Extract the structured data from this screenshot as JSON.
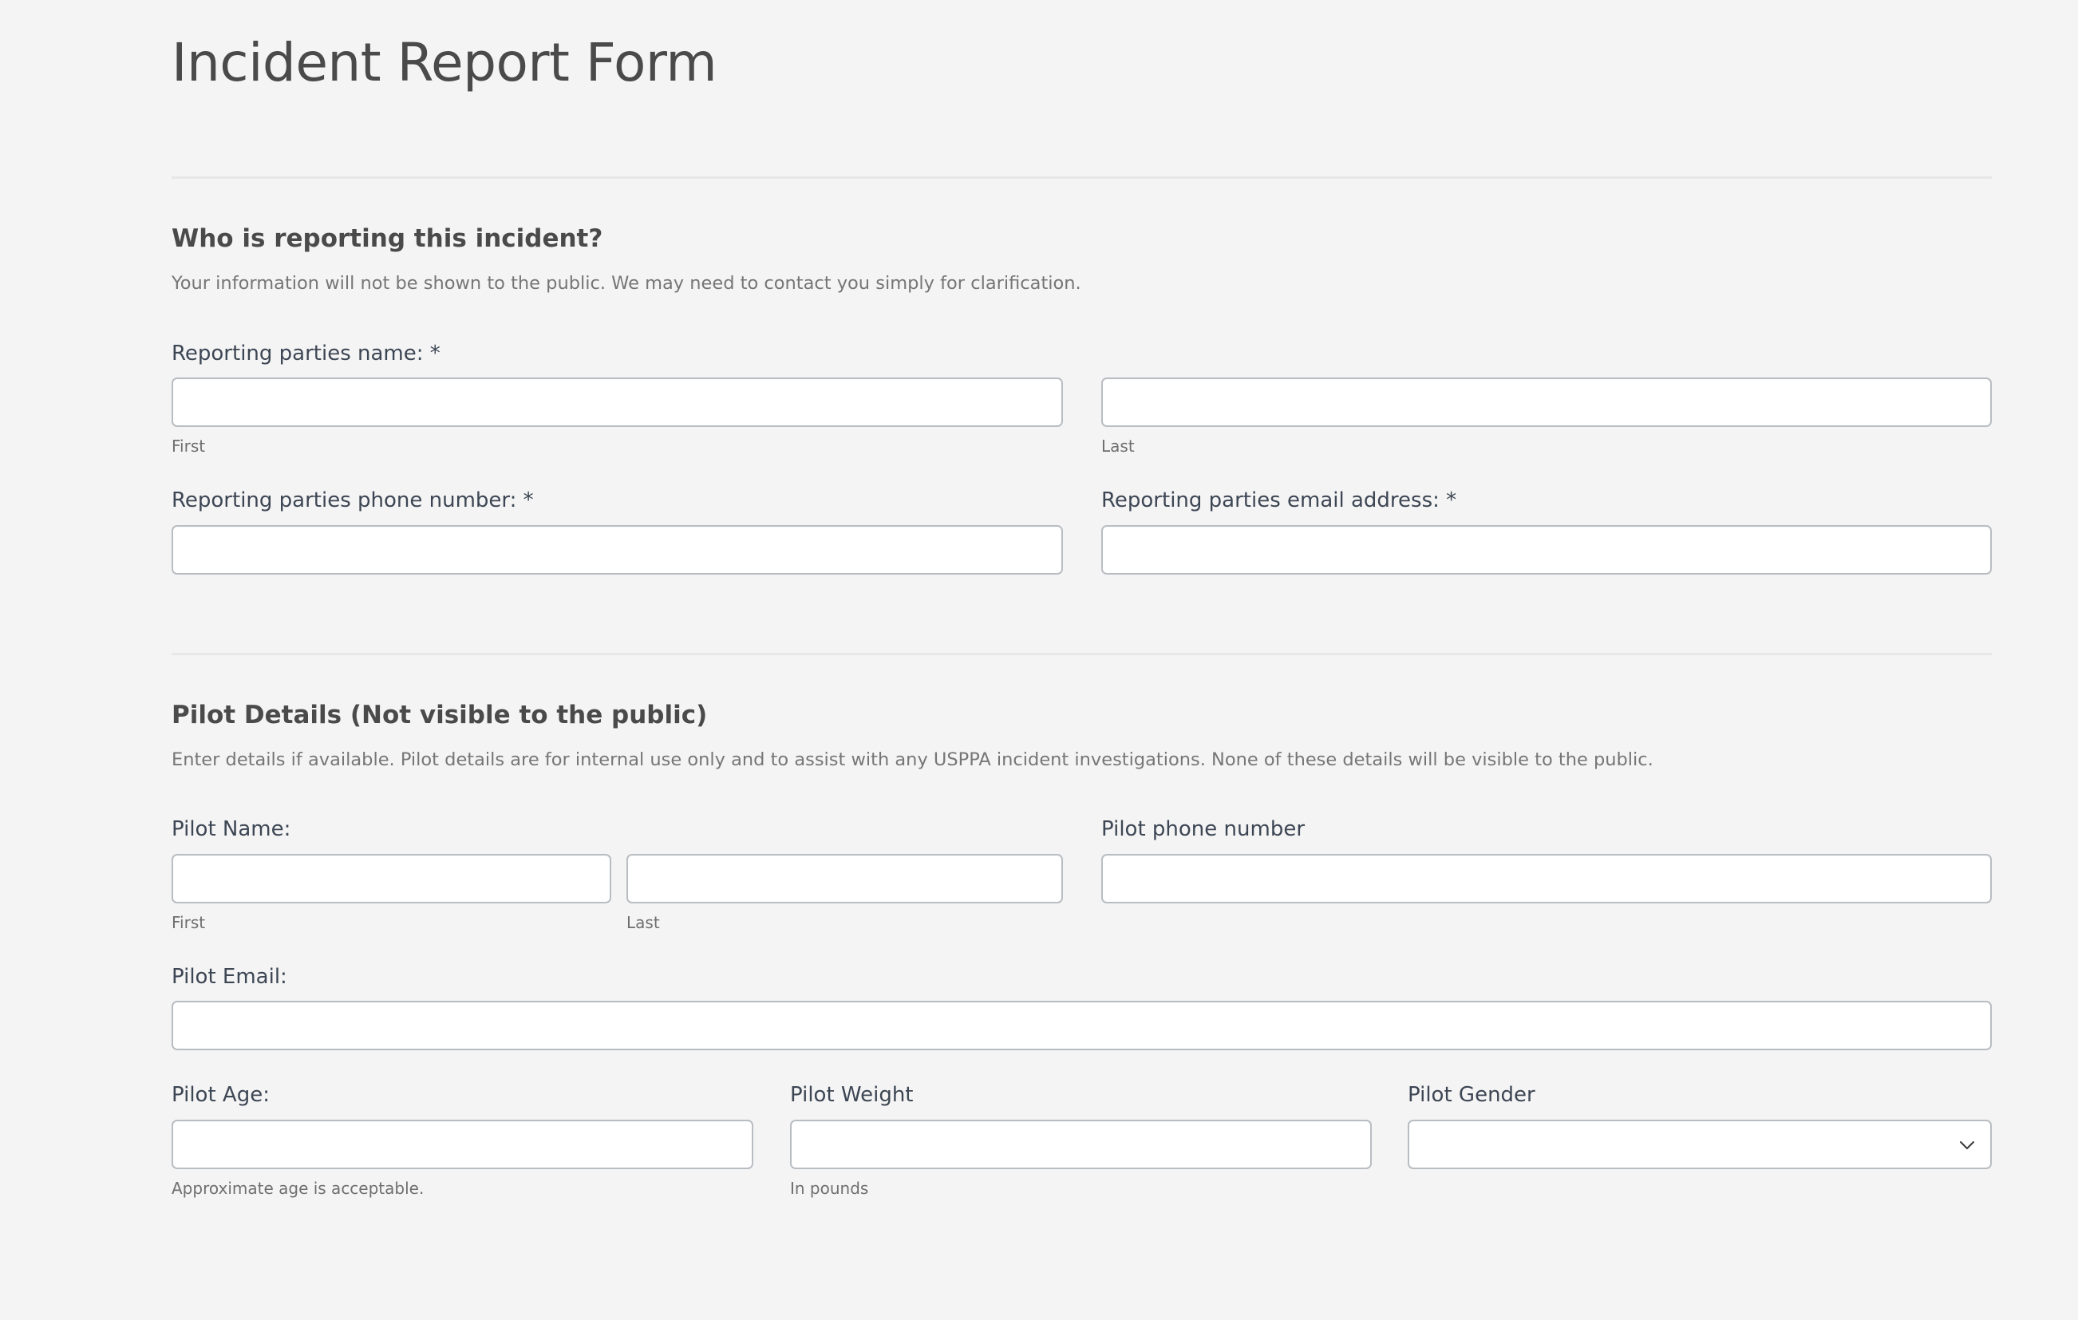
{
  "form": {
    "title": "Incident Report Form"
  },
  "sections": [
    {
      "heading": "Who is reporting this incident?",
      "description": "Your information will not be shown to the public. We may need to contact you simply for clarification."
    },
    {
      "heading": "Pilot Details (Not visible to the public)",
      "description": "Enter details if available. Pilot details are for internal use only and to assist with any USPPA incident investigations. None of these details will be visible to the public."
    }
  ],
  "fields": {
    "reporting_name": {
      "label": "Reporting parties name: *",
      "first": {
        "value": "",
        "placeholder": "",
        "sublabel": "First"
      },
      "last": {
        "value": "",
        "placeholder": "",
        "sublabel": "Last"
      }
    },
    "reporting_phone": {
      "label": "Reporting parties phone number: *",
      "value": "",
      "placeholder": ""
    },
    "reporting_email": {
      "label": "Reporting parties email address: *",
      "value": "",
      "placeholder": ""
    },
    "pilot_name": {
      "label": "Pilot Name:",
      "first": {
        "value": "",
        "placeholder": "",
        "sublabel": "First"
      },
      "last": {
        "value": "",
        "placeholder": "",
        "sublabel": "Last"
      }
    },
    "pilot_phone": {
      "label": "Pilot phone number",
      "value": "",
      "placeholder": ""
    },
    "pilot_email": {
      "label": "Pilot Email:",
      "value": "",
      "placeholder": ""
    },
    "pilot_age": {
      "label": "Pilot Age:",
      "value": "",
      "placeholder": "",
      "hint": "Approximate age is acceptable."
    },
    "pilot_weight": {
      "label": "Pilot Weight",
      "value": "",
      "placeholder": "",
      "hint": "In pounds"
    },
    "pilot_gender": {
      "label": "Pilot Gender",
      "selected": "",
      "options": [
        ""
      ],
      "icon": "chevron-down-icon"
    }
  },
  "colors": {
    "page_background": "#f4f4f4",
    "title_text": "#4a4a4a",
    "label_text": "#3d4654",
    "muted_text": "#767676",
    "input_border": "#b9bdc2",
    "input_background": "#ffffff",
    "divider": "#e7e7e7"
  }
}
